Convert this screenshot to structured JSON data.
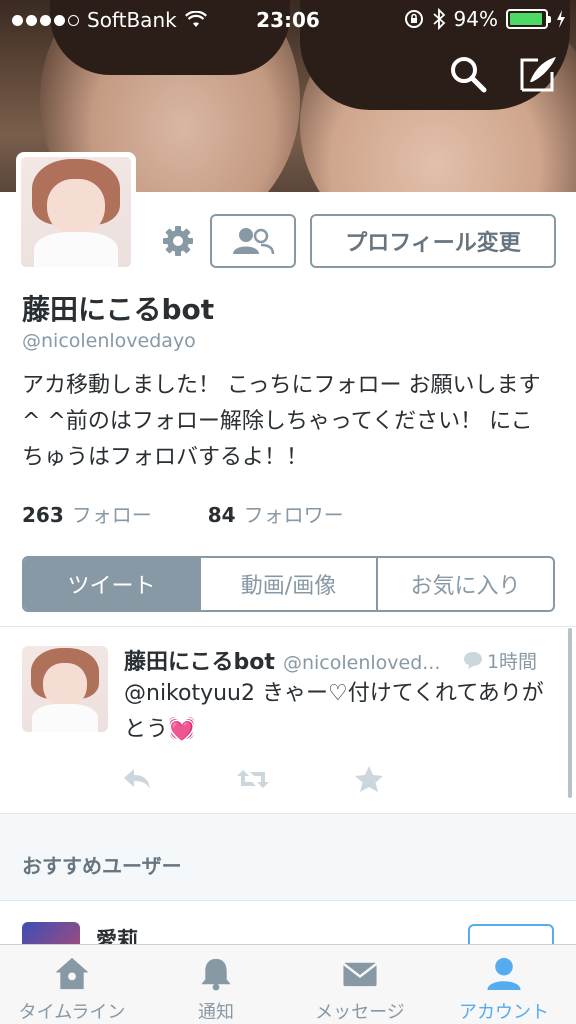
{
  "status_bar": {
    "carrier": "SoftBank",
    "time": "23:06",
    "battery_percent": "94%",
    "battery_level": 0.94,
    "signal_bars_filled": 4,
    "signal_bars_total": 5
  },
  "header": {
    "icons": [
      "search-icon",
      "compose-icon"
    ]
  },
  "profile": {
    "display_name": "藤田にこるbot",
    "handle": "@nicolenlovedayo",
    "bio": "アカ移動しました！ こっちにフォロー お願いします^ ^前のはフォロー解除しちゃってください！ にこちゅうはフォロバするよ！！",
    "edit_button_label": "プロフィール変更",
    "following_count": "263",
    "following_label": "フォロー",
    "followers_count": "84",
    "followers_label": "フォロワー"
  },
  "tabs": [
    {
      "label": "ツイート",
      "active": true
    },
    {
      "label": "動画/画像",
      "active": false
    },
    {
      "label": "お気に入り",
      "active": false
    }
  ],
  "tweet": {
    "author_name": "藤田にこるbot",
    "author_handle": "@nicolenloved...",
    "time": "1時間",
    "text": "@nikotyuu2 きゃー♡付けてくれてありがとう",
    "emoji": "💓"
  },
  "recommended": {
    "title": "おすすめユーザー",
    "user_name": "愛莉"
  },
  "tab_bar": [
    {
      "label": "タイムライン",
      "icon": "home-icon",
      "active": false
    },
    {
      "label": "通知",
      "icon": "bell-icon",
      "active": false
    },
    {
      "label": "メッセージ",
      "icon": "envelope-icon",
      "active": false
    },
    {
      "label": "アカウント",
      "icon": "person-icon",
      "active": true
    }
  ],
  "colors": {
    "accent": "#55acee",
    "muted": "#8899a6",
    "text": "#292f33",
    "battery": "#4cd964"
  }
}
